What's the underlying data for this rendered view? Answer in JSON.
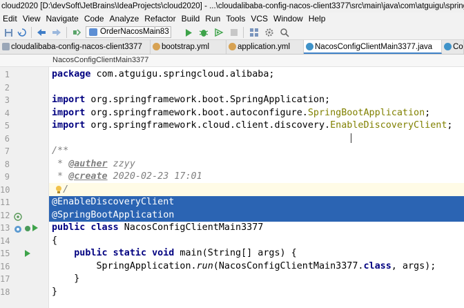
{
  "window": {
    "title": "cloud2020 [D:\\devSoft\\JetBrains\\IdeaProjects\\cloud2020] - ...\\cloudalibaba-config-nacos-client3377\\src\\main\\java\\com\\atguigu\\springcloud\\alibaba\\NacosConfigClientMain3377.java"
  },
  "menu": [
    "Edit",
    "View",
    "Navigate",
    "Code",
    "Analyze",
    "Refactor",
    "Build",
    "Run",
    "Tools",
    "VCS",
    "Window",
    "Help"
  ],
  "toolbar": {
    "run_config": "OrderNacosMain83",
    "icons": [
      "save-all-icon",
      "sync-icon",
      "back-icon",
      "forward-icon",
      "build-icon",
      "run-icon",
      "debug-icon",
      "coverage-icon",
      "stop-icon",
      "project-structure-icon",
      "settings-icon",
      "search-icon"
    ]
  },
  "tabs": [
    {
      "label": "cloudalibaba-config-nacos-client3377",
      "icon": "module-icon",
      "active": false
    },
    {
      "label": "bootstrap.yml",
      "icon": "yaml-icon",
      "active": false
    },
    {
      "label": "application.yml",
      "icon": "yaml-icon",
      "active": false
    },
    {
      "label": "NacosConfigClientMain3377.java",
      "icon": "class-icon",
      "active": true
    },
    {
      "label": "Co",
      "icon": "class-icon",
      "active": false
    }
  ],
  "breadcrumb": "NacosConfigClientMain3377",
  "gutter": {
    "line_numbers": [
      "1",
      "2",
      "3",
      "4",
      "5",
      "6",
      "7",
      "8",
      "9",
      "10",
      "11",
      "12",
      "13",
      "14",
      "15",
      "16",
      "17",
      "18"
    ]
  },
  "code": {
    "l1_kw": "package",
    "l1_rest": " com.atguigu.springcloud.alibaba;",
    "l3_kw": "import",
    "l3_rest": " org.springframework.boot.SpringApplication;",
    "l4_kw": "import",
    "l4_pre": " org.springframework.boot.autoconfigure.",
    "l4_ann": "SpringBootApplication",
    "l4_end": ";",
    "l5_kw": "import",
    "l5_pre": " org.springframework.cloud.client.discovery.",
    "l5_ann": "EnableDiscoveryClient",
    "l5_end": ";",
    "l7": "/**",
    "l8_star": " * ",
    "l8_tag": "@auther",
    "l8_val": " zzyy",
    "l9_star": " * ",
    "l9_tag": "@create",
    "l9_val": " 2020-02-23 17:01",
    "l10_end": "/",
    "l11": "@EnableDiscoveryClient",
    "l12": "@SpringBootApplication",
    "l13_kw": "public class",
    "l13_name": " NacosConfigClientMain3377",
    "l14": "{",
    "l15_indent": "    ",
    "l15_kw": "public static void",
    "l15_rest": " main(String[] args) {",
    "l16_pre": "        SpringApplication.",
    "l16_run": "run",
    "l16_mid": "(NacosConfigClientMain3377.",
    "l16_kw": "class",
    "l16_end": ", args);",
    "l17": "    }",
    "l18": "}"
  }
}
